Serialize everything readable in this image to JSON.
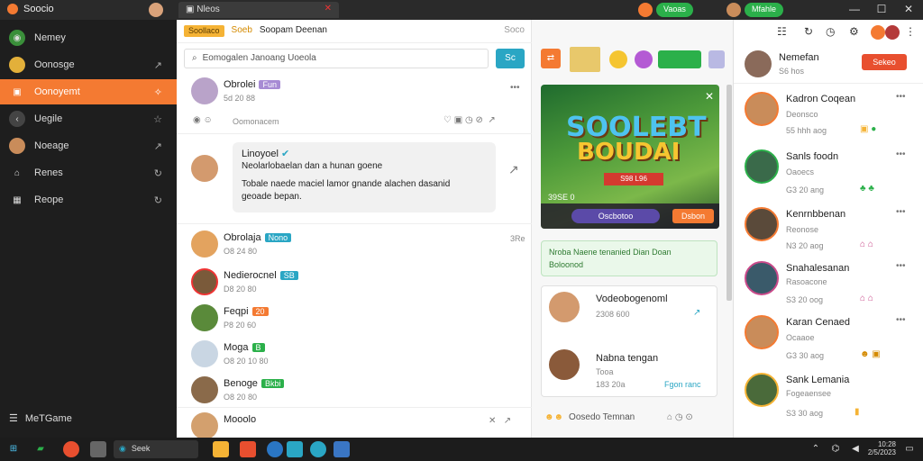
{
  "titlebar": {
    "app_name": "Soocio",
    "tab_title": "Nleos"
  },
  "top_right_pills": [
    {
      "label": "Vaoas"
    },
    {
      "label": "Mfahle"
    }
  ],
  "sidebar": {
    "items": [
      {
        "label": "Nemey",
        "icon": "globe-icon"
      },
      {
        "label": "Oonosge",
        "icon": "user-icon"
      },
      {
        "label": "Oonoyemt",
        "icon": "briefcase-icon"
      },
      {
        "label": "Uegile",
        "icon": "arrow-icon"
      },
      {
        "label": "Noeage",
        "icon": "person-icon"
      },
      {
        "label": "Renes",
        "icon": "home-icon"
      },
      {
        "label": "Reope",
        "icon": "grid-icon"
      }
    ],
    "footer_label": "MeTGame"
  },
  "center": {
    "header_badge": "Soollaco",
    "header_subbadge": "Soeb",
    "header_title": "Soopam Deenan",
    "header_right": "Soco",
    "search_placeholder": "Eomogalen Janoang Uoeola",
    "search_button": "Sc",
    "posts": [
      {
        "name": "Obrolei",
        "tag": "Fun",
        "time": "5d 20 88"
      },
      {
        "name": "Oobrolei",
        "sub": "Oomonacem"
      }
    ],
    "bubble": {
      "name": "Linoyoel",
      "line1": "Neolarlobaelan dan a hunan goene",
      "line2": "Tobale naede maciel lamor gnande alachen dasanid",
      "line3": "geoade bepan."
    },
    "rows": [
      {
        "name": "Obrolaja",
        "tag": "Nono",
        "sub": "O8 24 80",
        "right": "3Re"
      },
      {
        "name": "Nedierocnel",
        "tag": "SB",
        "sub": "D8 20 80"
      },
      {
        "name": "Feqpi",
        "tag": "20",
        "sub": "P8 20 60"
      },
      {
        "name": "Moga",
        "tag": "B",
        "sub": "O8 20 10 80"
      },
      {
        "name": "Benoge",
        "tag": "Bkbi",
        "sub": "O8 20 80"
      },
      {
        "name": "Mooolo",
        "sub": ""
      }
    ]
  },
  "mid": {
    "banner": {
      "title1": "SOOLEBT",
      "title2": "BOUDAI",
      "ribbon": "S98 L96",
      "count": "39SE 0",
      "pill": "Oscbotoo",
      "cta": "Dsbon"
    },
    "notice": {
      "line1": "Nroba Naene tenanied Dian Doan",
      "line2": "Boloonod"
    },
    "contacts": [
      {
        "name": "Vodeobogenoml",
        "sub": "2308 600"
      },
      {
        "name": "Nabna tengan",
        "sub": "Tooa",
        "sub2": "183 20a",
        "link": "Fgon ranc"
      }
    ],
    "footer": "Oosedo Temnan"
  },
  "right": {
    "user": {
      "name": "Nemefan",
      "sub": "S6 hos",
      "button": "Sekeo"
    },
    "friends": [
      {
        "name": "Kadron Coqean",
        "sub": "Deonsco",
        "time": "55 hhh aog"
      },
      {
        "name": "Sanls foodn",
        "sub": "Oaoecs",
        "time": "G3 20 ang"
      },
      {
        "name": "Kenrnbbenan",
        "sub": "Reonose",
        "time": "N3 20 aog"
      },
      {
        "name": "Snahalesanan",
        "sub": "Rasoacone",
        "time": "S3 20 oog"
      },
      {
        "name": "Karan Cenaed",
        "sub": "Ocaaoe",
        "time": "G3 30 aog"
      },
      {
        "name": "Sank Lemania",
        "sub": "Fogeaensee",
        "time": "S3 30 aog"
      }
    ]
  },
  "taskbar": {
    "search_label": "Seek",
    "time": "10:28",
    "date": "2/5/2023"
  },
  "colors": {
    "accent": "#f47a32",
    "green": "#2bb04a",
    "teal": "#2aa6c4"
  }
}
